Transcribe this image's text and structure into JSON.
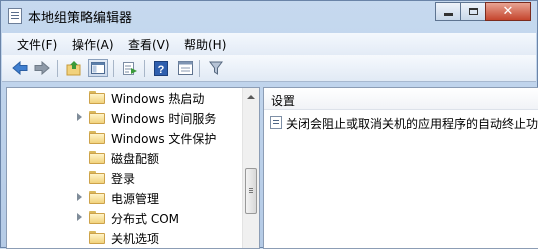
{
  "window": {
    "title": "本地组策略编辑器"
  },
  "menu": [
    "文件(F)",
    "操作(A)",
    "查看(V)",
    "帮助(H)"
  ],
  "toolbar": {
    "icons": [
      "back-icon",
      "forward-icon",
      "up-folder-icon",
      "show-hide-tree-icon",
      "export-list-icon",
      "help-icon",
      "properties-icon",
      "filter-icon"
    ]
  },
  "tree": {
    "items": [
      {
        "label": "Windows 热启动",
        "expandable": false
      },
      {
        "label": "Windows 时间服务",
        "expandable": true
      },
      {
        "label": "Windows 文件保护",
        "expandable": false
      },
      {
        "label": "磁盘配额",
        "expandable": false
      },
      {
        "label": "登录",
        "expandable": false
      },
      {
        "label": "电源管理",
        "expandable": true
      },
      {
        "label": "分布式 COM",
        "expandable": true
      },
      {
        "label": "关机选项",
        "expandable": false
      }
    ]
  },
  "list": {
    "header": "设置",
    "rows": [
      {
        "label": "关闭会阻止或取消关机的应用程序的自动终止功能"
      }
    ]
  },
  "colors": {
    "title_bar": "#c6d9ef",
    "close_button": "#c5452d",
    "folder": "#f1d27d"
  }
}
